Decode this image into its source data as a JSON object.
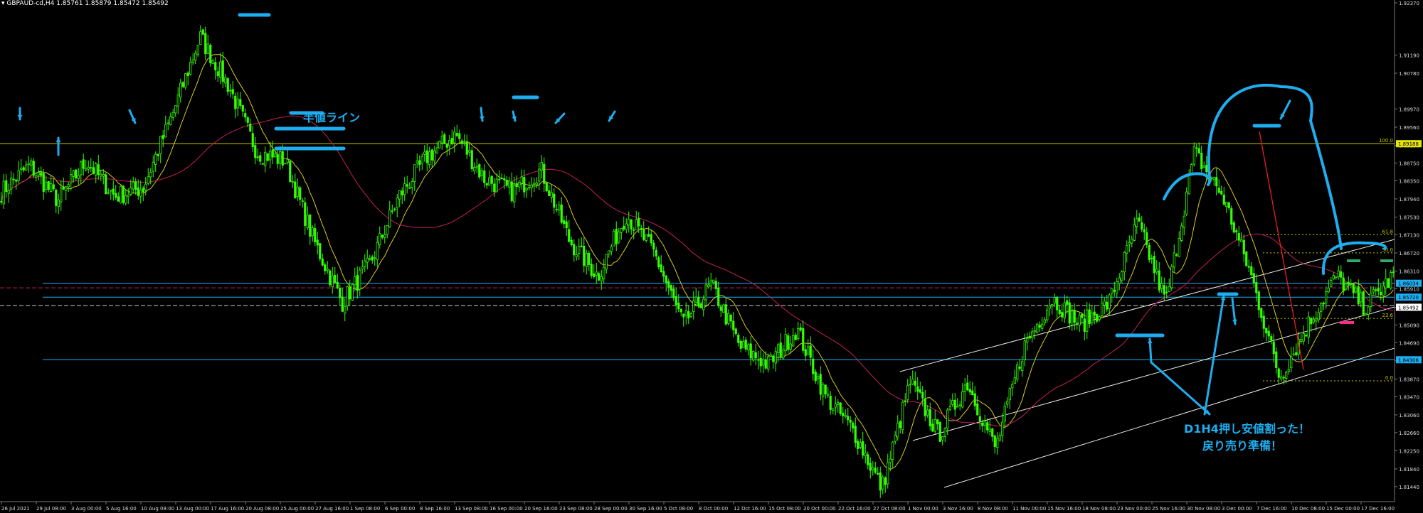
{
  "window": {
    "symbol_label": "GBPAUD-cd,H4",
    "ohlc": [
      "1.85761",
      "1.85879",
      "1.85472",
      "1.85492"
    ]
  },
  "colors": {
    "background": "#000000",
    "candle": "#33ff00",
    "ma_fast": "#d6cc22",
    "ma_slow": "#c21f5f",
    "annotation": "#1eaef0",
    "fib": "#c8c800",
    "channel": "#e8e8e8"
  },
  "annotations": {
    "half_value_line": "半値ライン",
    "note_line1": "D1H4押し安値割った！",
    "note_line2": "戻り売り準備！"
  },
  "fib_levels": [
    {
      "label": "100.0",
      "price": 1.89188
    },
    {
      "label": "61.8",
      "price": 1.8713
    },
    {
      "label": "50.0",
      "price": 1.8672
    },
    {
      "label": "23.6",
      "price": 1.8524
    },
    {
      "label": "0.0",
      "price": 1.8383
    }
  ],
  "chart_data": {
    "type": "candlestick",
    "symbol": "GBPAUD-cd",
    "timeframe": "H4",
    "ylim": [
      1.811,
      1.9237
    ],
    "y_ticks": [
      "1.92370",
      "1.91190",
      "1.90780",
      "1.89970",
      "1.89560",
      "1.89150",
      "1.88750",
      "1.88350",
      "1.87940",
      "1.87530",
      "1.87130",
      "1.86720",
      "1.86310",
      "1.85910",
      "1.85492",
      "1.85090",
      "1.84690",
      "1.84280",
      "1.83870",
      "1.83470",
      "1.83060",
      "1.82660",
      "1.82250",
      "1.81840",
      "1.81440"
    ],
    "x_ticks": [
      "26 Jul 2021",
      "29 Jul 08:00",
      "3 Aug 00:00",
      "5 Aug 16:00",
      "10 Aug 08:00",
      "13 Aug 00:00",
      "17 Aug 16:00",
      "20 Aug 08:00",
      "25 Aug 00:00",
      "27 Aug 16:00",
      "1 Sep 08:00",
      "6 Sep 00:00",
      "8 Sep 16:00",
      "13 Sep 08:00",
      "16 Sep 00:00",
      "20 Sep 16:00",
      "23 Sep 08:00",
      "28 Sep 00:00",
      "30 Sep 16:00",
      "5 Oct 08:00",
      "8 Oct 00:00",
      "12 Oct 16:00",
      "15 Oct 08:00",
      "20 Oct 00:00",
      "22 Oct 16:00",
      "27 Oct 08:00",
      "1 Nov 00:00",
      "3 Nov 16:00",
      "8 Nov 08:00",
      "11 Nov 00:00",
      "15 Nov 16:00",
      "18 Nov 08:00",
      "23 Nov 00:00",
      "25 Nov 16:00",
      "30 Nov 08:00",
      "3 Dec 00:00",
      "7 Dec 16:00",
      "10 Dec 08:00",
      "15 Dec 00:00",
      "17 Dec 16:00"
    ],
    "price_labels": [
      {
        "price": 1.89188,
        "text": "1.89188",
        "bg": "#e6e600",
        "fg": "#000000"
      },
      {
        "price": 1.86034,
        "text": "1.86034",
        "bg": "#1eaef0",
        "fg": "#000000"
      },
      {
        "price": 1.8572,
        "text": "1.85720",
        "bg": "#1eaef0",
        "fg": "#000000"
      },
      {
        "price": 1.85492,
        "text": "1.85492",
        "bg": "#ffffff",
        "fg": "#000000"
      },
      {
        "price": 1.84306,
        "text": "1.84306",
        "bg": "#1eaef0",
        "fg": "#000000"
      }
    ],
    "horizontal_lines": [
      {
        "price": 1.89188,
        "color": "#c8c800",
        "style": "solid"
      },
      {
        "price": 1.86034,
        "color": "#1eaef0",
        "style": "solid"
      },
      {
        "price": 1.8593,
        "color": "#c21f5f",
        "style": "dashed"
      },
      {
        "price": 1.8572,
        "color": "#1eaef0",
        "style": "solid"
      },
      {
        "price": 1.8553,
        "color": "#cccccc",
        "style": "dashed"
      },
      {
        "price": 1.84306,
        "color": "#1eaef0",
        "style": "solid"
      }
    ],
    "key_closes": [
      1.881,
      1.887,
      1.879,
      1.888,
      1.88,
      1.882,
      1.898,
      1.916,
      1.905,
      1.89,
      1.888,
      1.87,
      1.856,
      1.865,
      1.88,
      1.889,
      1.894,
      1.884,
      1.881,
      1.886,
      1.87,
      1.862,
      1.876,
      1.867,
      1.851,
      1.86,
      1.846,
      1.842,
      1.85,
      1.835,
      1.827,
      1.814,
      1.838,
      1.826,
      1.838,
      1.823,
      1.846,
      1.857,
      1.851,
      1.856,
      1.874,
      1.856,
      1.89,
      1.88,
      1.862,
      1.839,
      1.851,
      1.862,
      1.855,
      1.862
    ]
  }
}
